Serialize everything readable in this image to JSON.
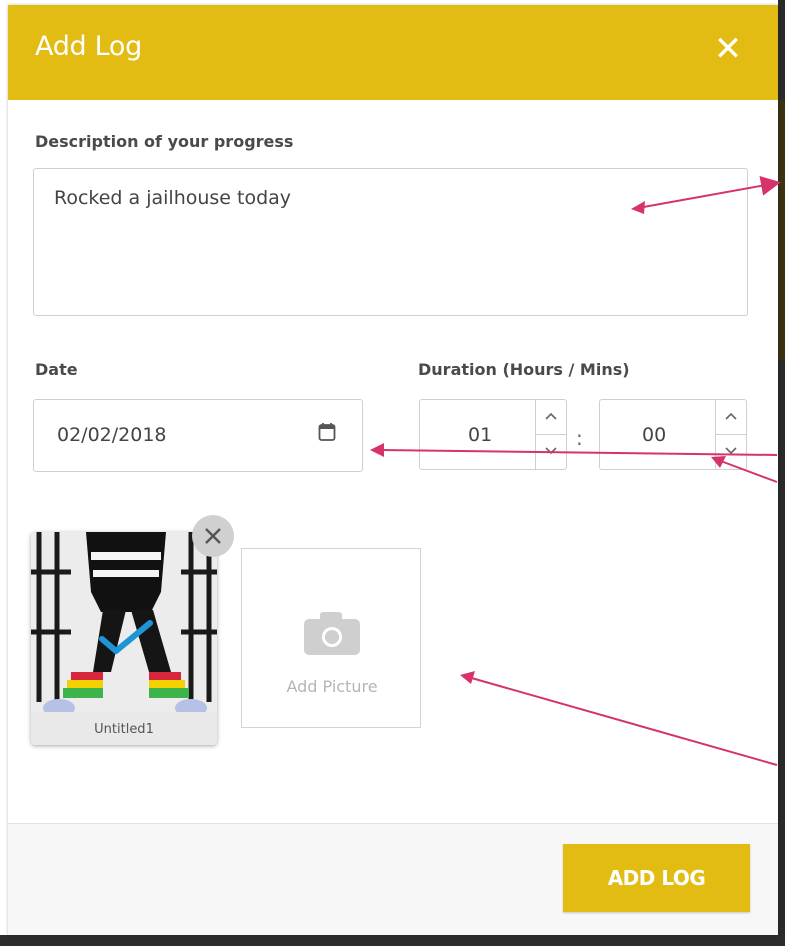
{
  "modal": {
    "title": "Add Log",
    "close_icon": "close-icon",
    "accent_color": "#e2bc12"
  },
  "form": {
    "description_label": "Description of your progress",
    "description_value": "Rocked a jailhouse today",
    "date_label": "Date",
    "date_value": "02/02/2018",
    "calendar_icon": "calendar-icon",
    "duration_label": "Duration (Hours / Mins)",
    "hours_value": "01",
    "minutes_value": "00",
    "separator": ":"
  },
  "pictures": {
    "items": [
      {
        "caption": "Untitled1",
        "selected_icon": "checkmark-icon"
      }
    ],
    "add_label": "Add Picture",
    "add_icon": "camera-icon"
  },
  "footer": {
    "submit_label": "ADD LOG"
  },
  "annotations": {
    "arrow_color": "#d6336c"
  }
}
